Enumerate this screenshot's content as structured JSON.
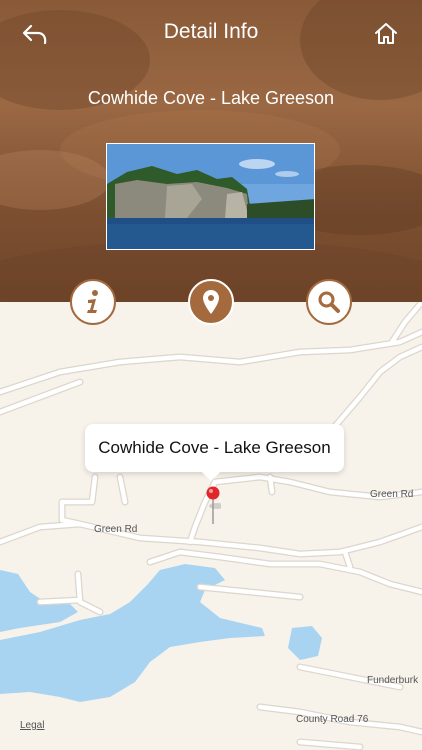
{
  "nav": {
    "title": "Detail Info",
    "back_icon": "back-arrow-icon",
    "home_icon": "home-icon"
  },
  "place": {
    "name": "Cowhide Cove - Lake Greeson"
  },
  "actions": [
    {
      "id": "info",
      "icon": "info-icon",
      "selected": false
    },
    {
      "id": "map",
      "icon": "location-pin-icon",
      "selected": true
    },
    {
      "id": "search",
      "icon": "search-icon",
      "selected": false
    }
  ],
  "map": {
    "callout_text": "Cowhide Cove - Lake Greeson",
    "road_labels": {
      "green_rd_right": "Green Rd",
      "green_rd_left": "Green Rd",
      "funderburk": "Funderburk",
      "county_road": "County Road 76"
    },
    "legal": "Legal"
  },
  "colors": {
    "accent": "#a46a3e",
    "header_brown": "#8a5a38",
    "map_land": "#f7f2ea",
    "map_water": "#a8d4f2",
    "pin_red": "#e0262b"
  }
}
